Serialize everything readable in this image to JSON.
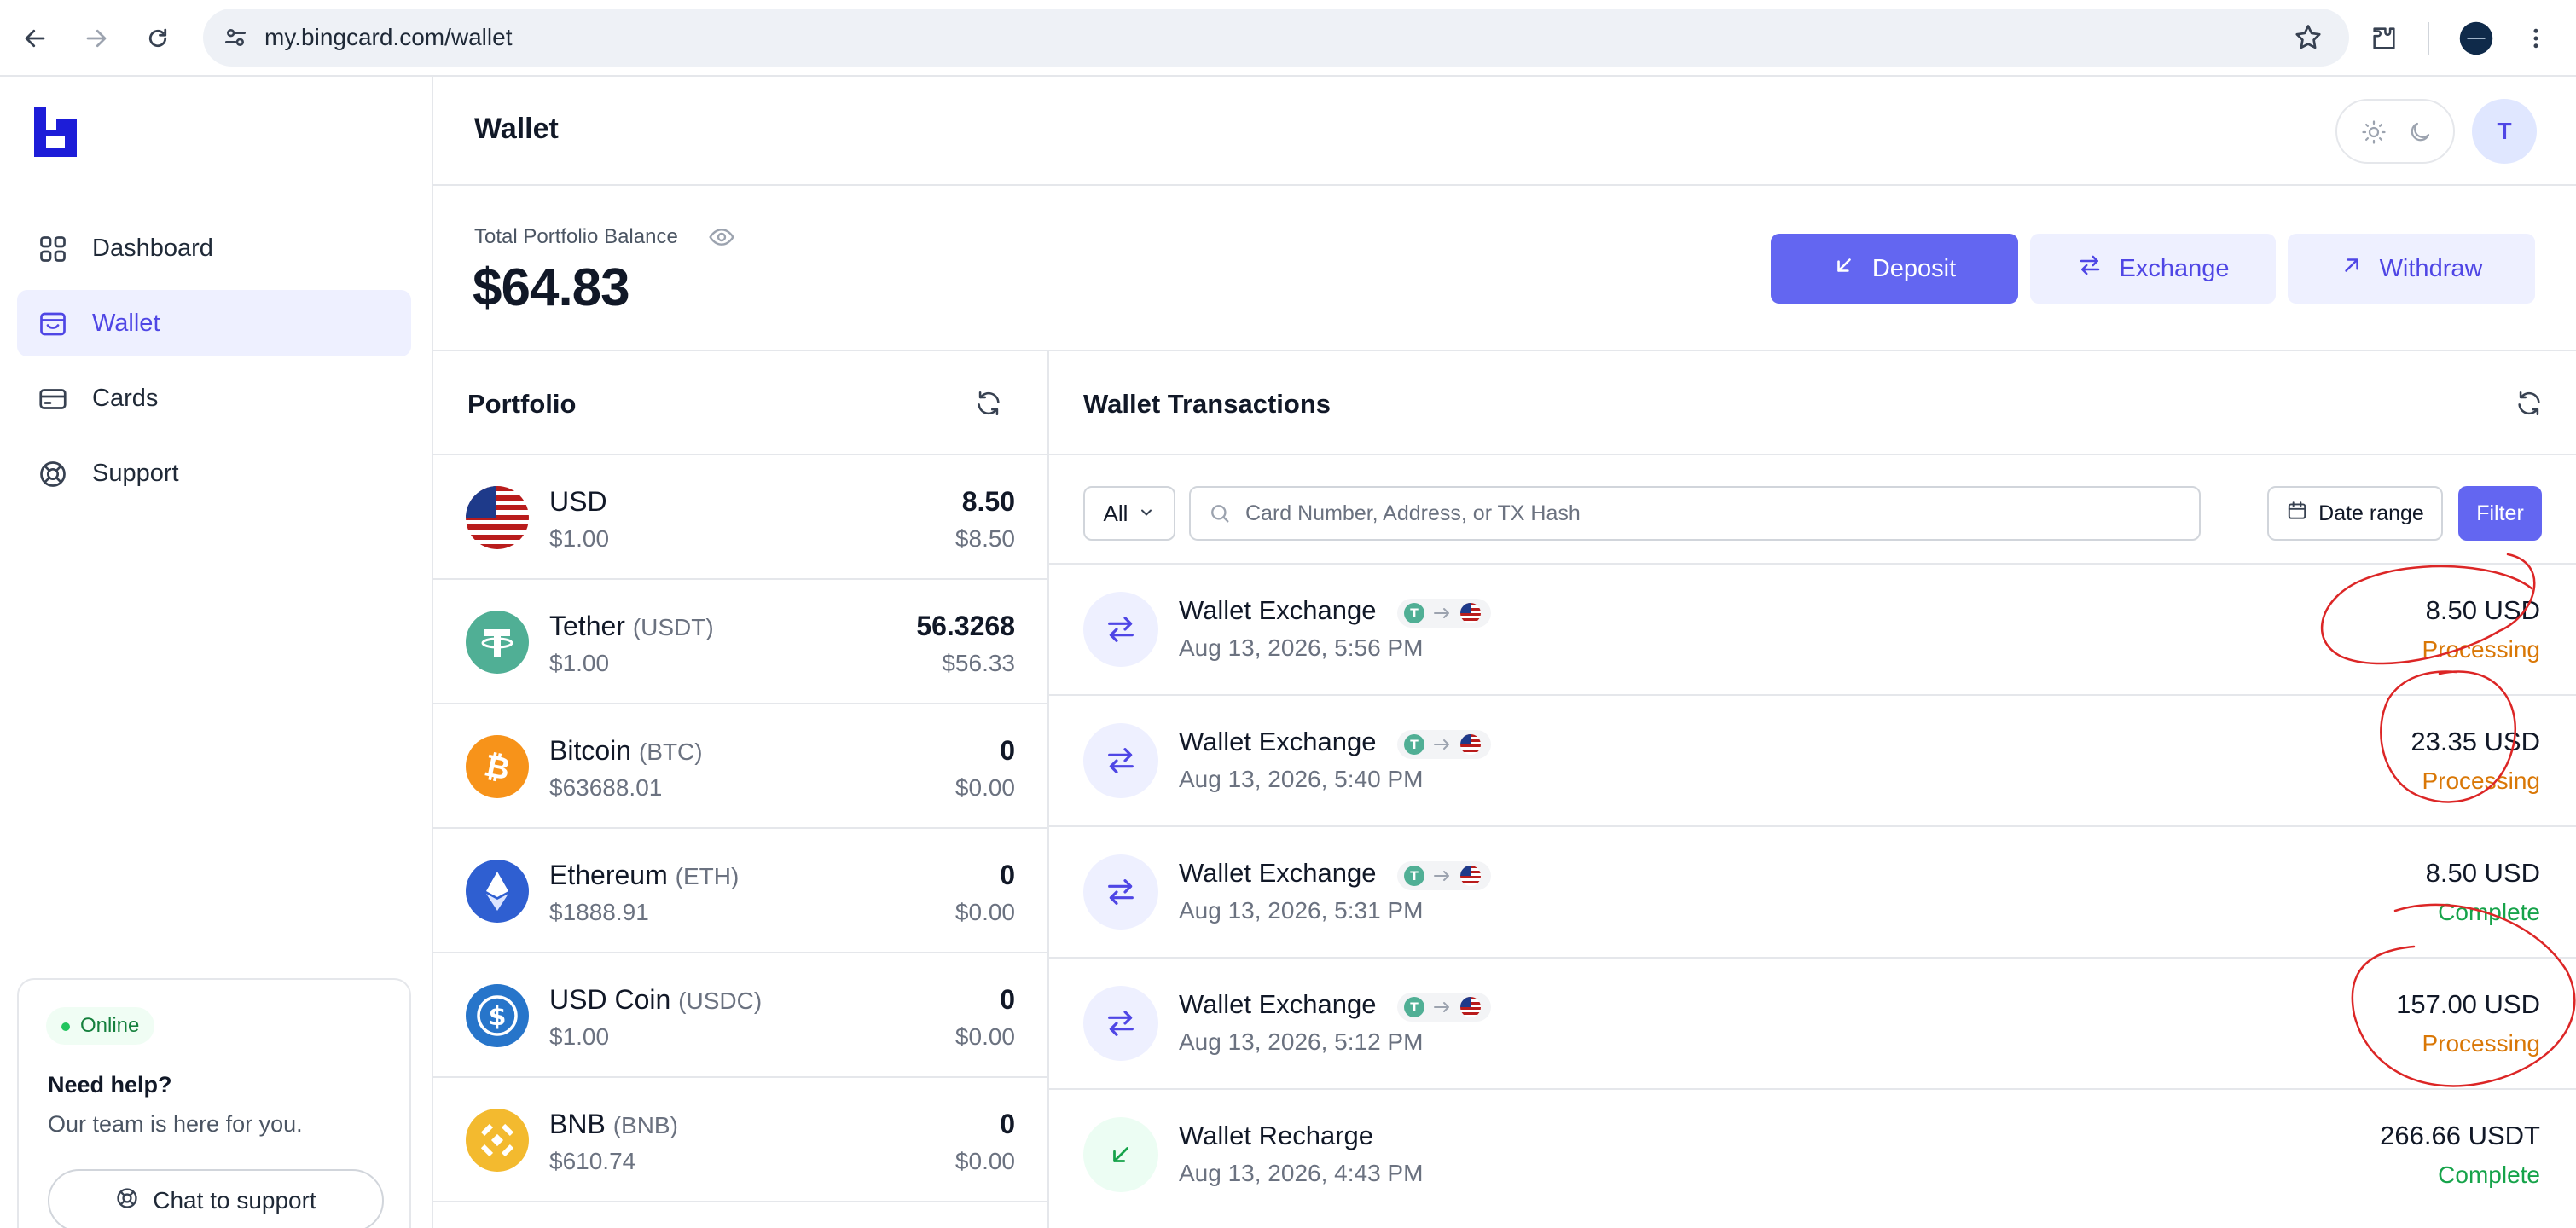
{
  "browser": {
    "url": "my.bingcard.com/wallet"
  },
  "sidebar": {
    "items": [
      {
        "label": "Dashboard",
        "icon": "grid-icon"
      },
      {
        "label": "Wallet",
        "icon": "wallet-icon",
        "active": true
      },
      {
        "label": "Cards",
        "icon": "card-icon"
      },
      {
        "label": "Support",
        "icon": "lifebuoy-icon"
      }
    ],
    "help": {
      "status": "Online",
      "title": "Need help?",
      "subtitle": "Our team is here for you.",
      "chat_label": "Chat to support"
    }
  },
  "header": {
    "title": "Wallet",
    "avatar_initial": "T"
  },
  "balance": {
    "label": "Total Portfolio Balance",
    "value": "$64.83",
    "actions": {
      "deposit": "Deposit",
      "exchange": "Exchange",
      "withdraw": "Withdraw"
    }
  },
  "portfolio": {
    "title": "Portfolio",
    "assets": [
      {
        "name": "USD",
        "symbol": "",
        "price": "$1.00",
        "amount": "8.50",
        "value": "$8.50",
        "color": "#b91c1c"
      },
      {
        "name": "Tether",
        "symbol": "(USDT)",
        "price": "$1.00",
        "amount": "56.3268",
        "value": "$56.33",
        "color": "#50af95"
      },
      {
        "name": "Bitcoin",
        "symbol": "(BTC)",
        "price": "$63688.01",
        "amount": "0",
        "value": "$0.00",
        "color": "#f7931a"
      },
      {
        "name": "Ethereum",
        "symbol": "(ETH)",
        "price": "$1888.91",
        "amount": "0",
        "value": "$0.00",
        "color": "#2f5fd1"
      },
      {
        "name": "USD Coin",
        "symbol": "(USDC)",
        "price": "$1.00",
        "amount": "0",
        "value": "$0.00",
        "color": "#2775ca"
      },
      {
        "name": "BNB",
        "symbol": "(BNB)",
        "price": "$610.74",
        "amount": "0",
        "value": "$0.00",
        "color": "#f3ba2f"
      }
    ]
  },
  "transactions": {
    "title": "Wallet Transactions",
    "filter": {
      "type_selected": "All",
      "search_placeholder": "Card Number, Address, or TX Hash",
      "date_label": "Date range",
      "filter_label": "Filter"
    },
    "items": [
      {
        "title": "Wallet Exchange",
        "date": "Aug 13, 2026, 5:56 PM",
        "amount": "8.50 USD",
        "status": "Processing",
        "kind": "exchange"
      },
      {
        "title": "Wallet Exchange",
        "date": "Aug 13, 2026, 5:40 PM",
        "amount": "23.35 USD",
        "status": "Processing",
        "kind": "exchange"
      },
      {
        "title": "Wallet Exchange",
        "date": "Aug 13, 2026, 5:31 PM",
        "amount": "8.50 USD",
        "status": "Complete",
        "kind": "exchange"
      },
      {
        "title": "Wallet Exchange",
        "date": "Aug 13, 2026, 5:12 PM",
        "amount": "157.00 USD",
        "status": "Processing",
        "kind": "exchange"
      },
      {
        "title": "Wallet Recharge",
        "date": "Aug 13, 2026, 4:43 PM",
        "amount": "266.66 USDT",
        "status": "Complete",
        "kind": "recharge"
      }
    ]
  },
  "colors": {
    "accent": "#6366f1",
    "processing": "#d97706",
    "complete": "#16a34a",
    "annotation": "#dc2626"
  }
}
